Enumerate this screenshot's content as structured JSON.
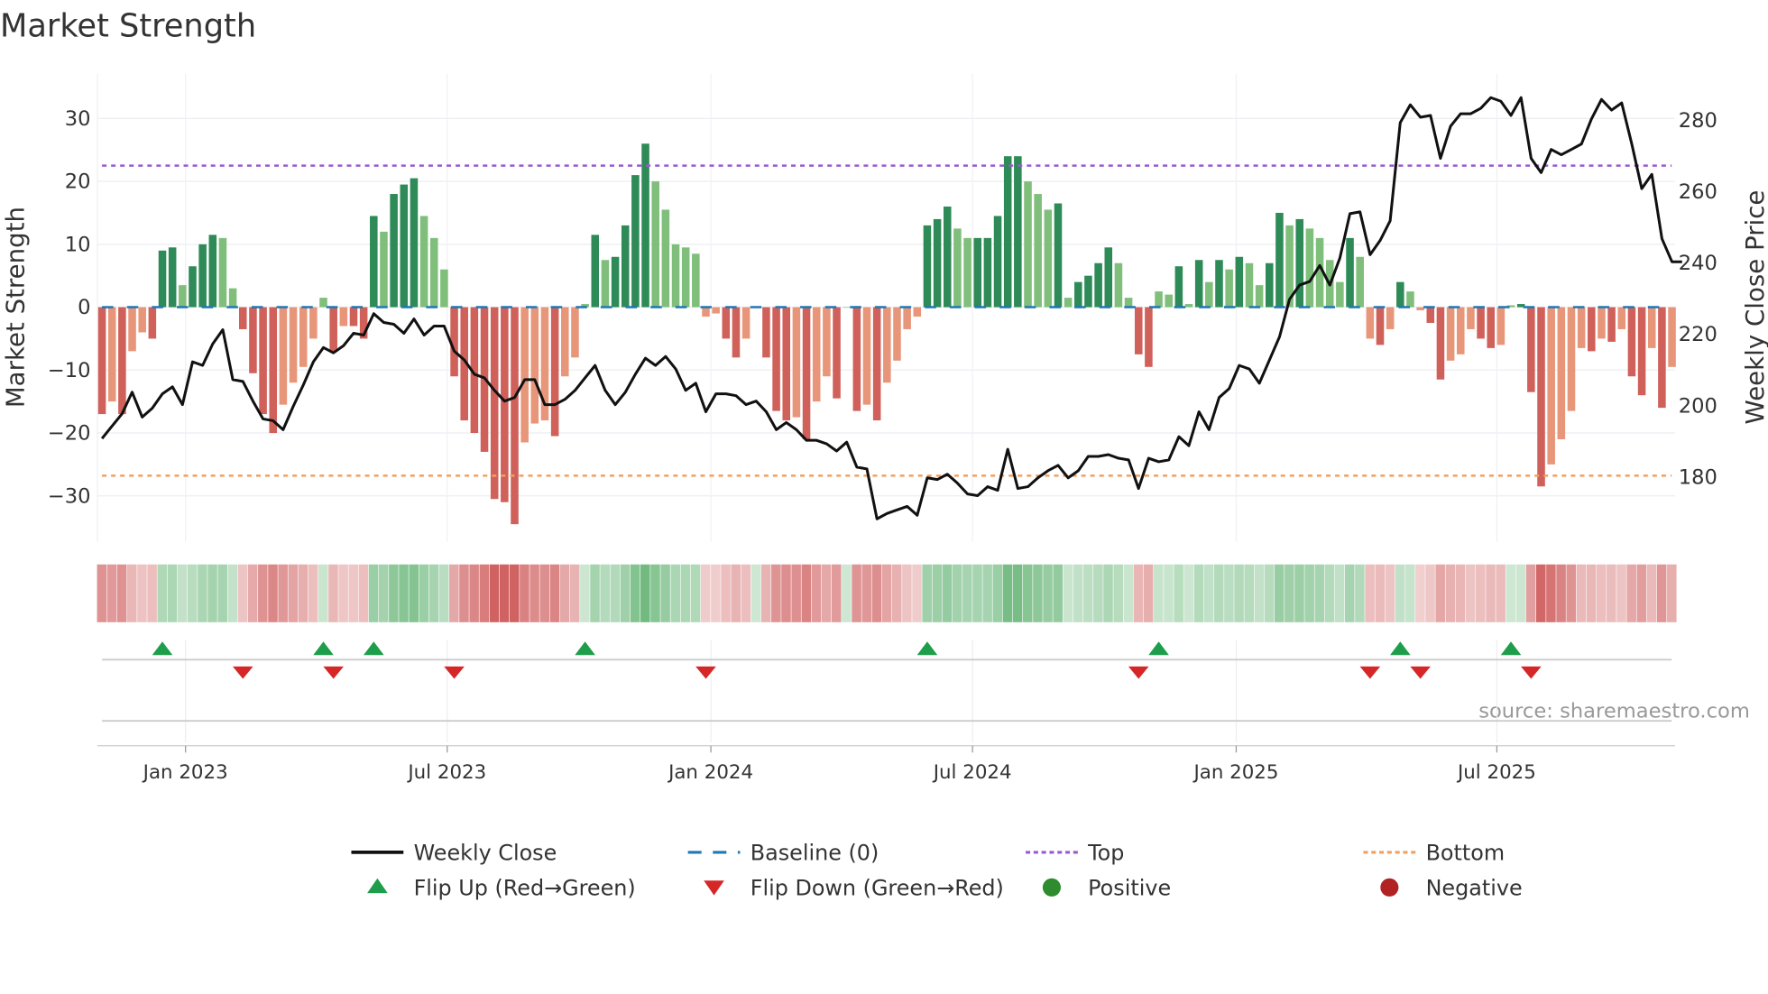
{
  "chart_data": {
    "type": "bar",
    "title": "Market Strength",
    "ylabel": "Market Strength",
    "y2label": "Weekly Close Price",
    "ylim": [
      -37,
      38
    ],
    "y2lim": [
      166,
      290
    ],
    "yticks": [
      "30",
      "20",
      "10",
      "0",
      "−10",
      "−20",
      "−30"
    ],
    "ytick_values": [
      30,
      20,
      10,
      0,
      -10,
      -20,
      -30
    ],
    "y2ticks": [
      "280",
      "260",
      "240",
      "220",
      "200",
      "180"
    ],
    "y2tick_values": [
      280,
      260,
      240,
      220,
      200,
      180
    ],
    "xticks": [
      "Jan 2023",
      "Jul 2023",
      "Jan 2024",
      "Jul 2024",
      "Jan 2025",
      "Jul 2025"
    ],
    "xtick_weeks": [
      8.3,
      34.3,
      60.5,
      86.5,
      112.7,
      138.6
    ],
    "top_level": 22.5,
    "bottom_level": -26.8,
    "source": "source: sharemaestro.com",
    "strength": [
      -17,
      -15,
      -17,
      -7,
      -4,
      -5,
      9,
      9.5,
      3.5,
      6.5,
      10,
      11.5,
      11,
      3,
      -3.5,
      -10.5,
      -17,
      -20,
      -15.5,
      -12,
      -9.5,
      -5,
      1.5,
      -7,
      -3,
      -3,
      -5,
      14.5,
      12,
      18,
      19.5,
      20.5,
      14.5,
      11,
      6,
      -11,
      -18,
      -20,
      -23,
      -30.5,
      -31,
      -34.5,
      -21.5,
      -18.5,
      -18,
      -20.5,
      -11,
      -8,
      0.5,
      11.5,
      7.5,
      8,
      13,
      21,
      26,
      20,
      15.5,
      10,
      9.5,
      8.5,
      -1.5,
      -1,
      -5,
      -8,
      -5,
      0,
      -8,
      -16.5,
      -18,
      -17.5,
      -21,
      -15,
      -11,
      -14.5,
      0,
      -16.5,
      -15.5,
      -18,
      -12,
      -8.5,
      -3.5,
      -1.5,
      13,
      14,
      16,
      12.5,
      11,
      11,
      11,
      14.5,
      24,
      24,
      20,
      18,
      15.5,
      16.5,
      1.5,
      4,
      5,
      7,
      9.5,
      7,
      1.5,
      -7.5,
      -9.5,
      2.5,
      2,
      6.5,
      0.5,
      7.5,
      4,
      7.5,
      6,
      8,
      7,
      3.5,
      7,
      15,
      13,
      14,
      12.5,
      11,
      7.5,
      4,
      11,
      8,
      -5,
      -6,
      -3.5,
      4,
      2.5,
      -0.5,
      -2.5,
      -11.5,
      -8.5,
      -7.5,
      -3.5,
      -5,
      -6.5,
      -6,
      0.3,
      0.5,
      -13.5,
      -28.5,
      -25,
      -21,
      -16.5,
      -6.5,
      -7,
      -5,
      -5.5,
      -3.5,
      -11,
      -14,
      -6.5,
      -16,
      -9.5
    ],
    "weekly_close": [
      190.5,
      194,
      197.5,
      203.5,
      196.5,
      199,
      203,
      205,
      200,
      212,
      211,
      217,
      221,
      207,
      206.5,
      201,
      196,
      195.5,
      193,
      199.5,
      205.5,
      212,
      216,
      214.5,
      216.5,
      220,
      219.5,
      225.5,
      223,
      222.5,
      220,
      224,
      219.5,
      222,
      222,
      215,
      212.5,
      208.5,
      207.5,
      204,
      201,
      202,
      207,
      207,
      200,
      200,
      201.5,
      204,
      207.5,
      211,
      204,
      200,
      203.5,
      208.5,
      213,
      211,
      213.5,
      210,
      204,
      206,
      198,
      203,
      203,
      202.5,
      200,
      201,
      198,
      193,
      195,
      193,
      190,
      190,
      189,
      187,
      189.5,
      182.5,
      182,
      168,
      169.5,
      170.5,
      171.5,
      169,
      179.5,
      179,
      180.5,
      178,
      175,
      174.5,
      177,
      176,
      187.5,
      176.5,
      177,
      179.5,
      181.5,
      183,
      179.5,
      181.5,
      185.5,
      185.5,
      186,
      185,
      184.5,
      176.5,
      185,
      184,
      184.5,
      191,
      188.5,
      198,
      193,
      202,
      204.5,
      211,
      210,
      206,
      212.5,
      219,
      229.5,
      233.5,
      234.5,
      239,
      233.5,
      241,
      253.5,
      254,
      242,
      246,
      251.5,
      279,
      284,
      280.5,
      281,
      269,
      278,
      281.5,
      281.5,
      283,
      286,
      285,
      281,
      286,
      269,
      265,
      271.5,
      270,
      271.5,
      273,
      280,
      285.5,
      282.5,
      284.5,
      273,
      260.5,
      264.5,
      246.5,
      240,
      240
    ],
    "flip_up_weeks": [
      6,
      22,
      27,
      48,
      82,
      105,
      129,
      140
    ],
    "flip_down_weeks": [
      14,
      23,
      35,
      60,
      103,
      126,
      131,
      142
    ],
    "legend": [
      {
        "label": "Weekly Close",
        "style": "line",
        "color": "#111111"
      },
      {
        "label": "Baseline (0)",
        "style": "dash",
        "color": "#1f77b4"
      },
      {
        "label": "Top",
        "style": "dot",
        "color": "#9b59d0"
      },
      {
        "label": "Bottom",
        "style": "dot",
        "color": "#f0a060"
      },
      {
        "label": "Flip Up (Red→Green)",
        "style": "tri-up",
        "color": "#1e9e4a"
      },
      {
        "label": "Flip Down (Green→Red)",
        "style": "tri-down",
        "color": "#d62728"
      },
      {
        "label": "Positive",
        "style": "circle",
        "color": "#2e8b2e"
      },
      {
        "label": "Negative",
        "style": "circle",
        "color": "#b22222"
      }
    ],
    "colors": {
      "pos_dark": "#2e8b57",
      "pos_light": "#7fbf7b",
      "neg_dark": "#d0605a",
      "neg_light": "#e8967a",
      "baseline": "#1f77b4",
      "top": "#9b59d0",
      "bottom": "#f0a060",
      "line": "#111111"
    }
  }
}
